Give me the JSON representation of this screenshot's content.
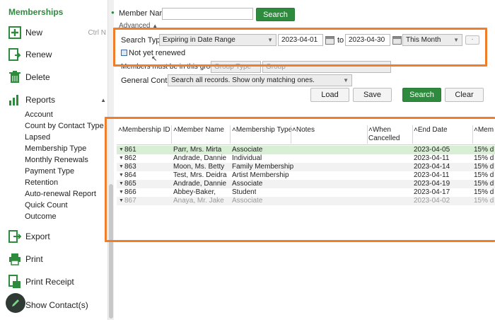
{
  "sidebar": {
    "title": "Memberships",
    "new_label": "New",
    "new_shortcut": "Ctrl N",
    "renew_label": "Renew",
    "delete_label": "Delete",
    "reports_label": "Reports",
    "reports_items": [
      "Account",
      "Count by Contact Type",
      "Lapsed",
      "Membership Type",
      "Monthly Renewals",
      "Payment Type",
      "Retention",
      "Auto-renewal Report",
      "Quick Count",
      "Outcome"
    ],
    "export_label": "Export",
    "print_label": "Print",
    "print_receipt_label": "Print Receipt",
    "show_contacts_label": "Show Contact(s)"
  },
  "search": {
    "member_name_label": "Member Name",
    "member_name_value": "",
    "search_button": "Search",
    "advanced_label": "Advanced",
    "search_type_label": "Search Type:",
    "search_type_value": "Expiring in Date Range",
    "date_from": "2023-04-01",
    "to_label": "to",
    "date_to": "2023-04-30",
    "period_value": "This Month",
    "not_renewed_label": "Not yet renewed",
    "must_be_group_label": "Members must be in this group:",
    "group_type_value": "Group Type",
    "group_value": "Group",
    "general_control_label": "General Control:",
    "general_control_value": "Search all records. Show only matching ones.",
    "load_button": "Load",
    "save_button": "Save",
    "search_button2": "Search",
    "clear_button": "Clear"
  },
  "table": {
    "headers": [
      "Membership ID",
      "Member Name",
      "Membership Type",
      "Notes",
      "When Cancelled",
      "End Date",
      "Mem"
    ],
    "rows": [
      {
        "id": "861",
        "name": "Parr, Mrs. Mirta",
        "type": "Associate",
        "notes": "",
        "cancelled": "",
        "end": "2023-04-05",
        "mem": "15% d"
      },
      {
        "id": "862",
        "name": "Andrade, Dannie",
        "type": "Individual",
        "notes": "",
        "cancelled": "",
        "end": "2023-04-11",
        "mem": "15% d"
      },
      {
        "id": "863",
        "name": "Moon, Ms. Betty",
        "type": "Family Membership",
        "notes": "",
        "cancelled": "",
        "end": "2023-04-14",
        "mem": "15% d"
      },
      {
        "id": "864",
        "name": "Test, Mrs. Deidra",
        "type": "Artist Membership",
        "notes": "",
        "cancelled": "",
        "end": "2023-04-11",
        "mem": "15% d"
      },
      {
        "id": "865",
        "name": "Andrade, Dannie",
        "type": "Associate",
        "notes": "",
        "cancelled": "",
        "end": "2023-04-19",
        "mem": "15% d"
      },
      {
        "id": "866",
        "name": "Abbey-Baker,",
        "type": "Student",
        "notes": "",
        "cancelled": "",
        "end": "2023-04-17",
        "mem": "15% d"
      },
      {
        "id": "867",
        "name": "Anaya, Mr. Jake",
        "type": "Associate",
        "notes": "",
        "cancelled": "",
        "end": "2023-04-02",
        "mem": "15% d"
      }
    ]
  },
  "colors": {
    "accent_green": "#2e8b3e",
    "highlight_orange": "#f07d2a",
    "selected_row": "#d9efd5"
  }
}
